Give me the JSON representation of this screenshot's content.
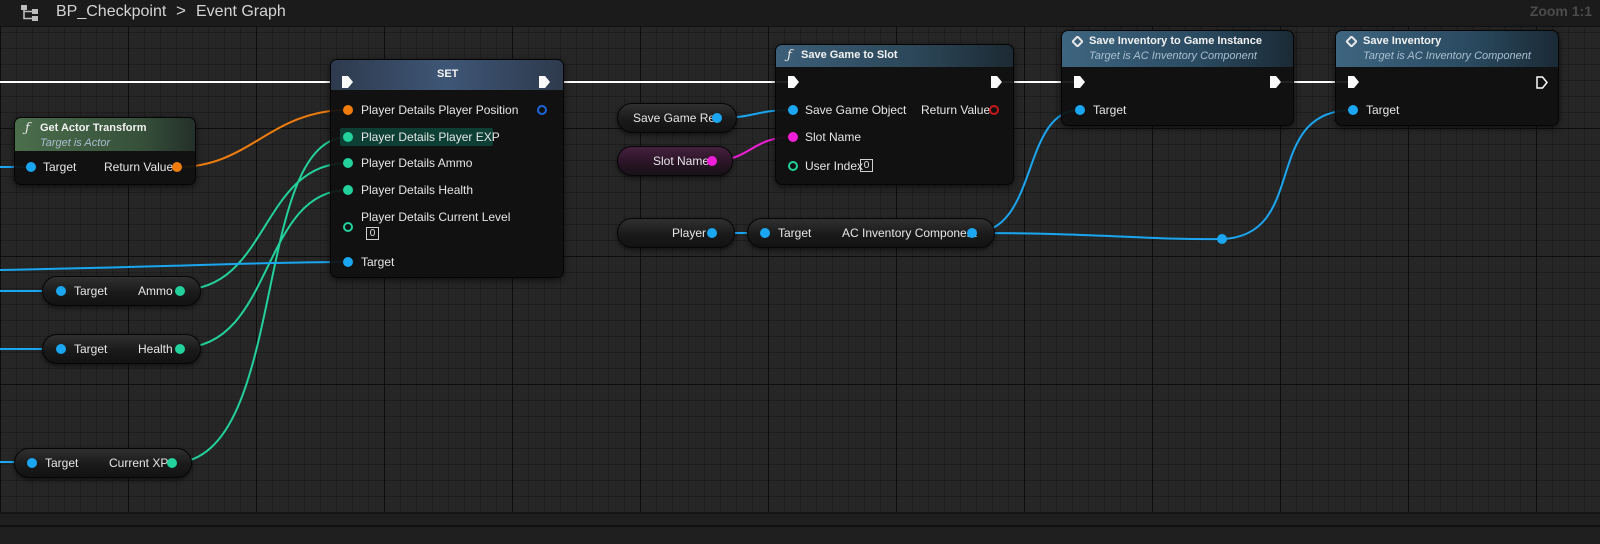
{
  "header": {
    "asset_name": "BP_Checkpoint",
    "separator": ">",
    "graph_name": "Event Graph",
    "zoom": "Zoom 1:1",
    "icon": "graph-hierarchy-icon"
  },
  "nodes": {
    "set": {
      "title": "SET",
      "pins": [
        "Player Details Player Position",
        "Player Details Player EXP",
        "Player Details Ammo",
        "Player Details Health",
        "Player Details Current Level",
        "Target"
      ],
      "current_level_value": "0"
    },
    "get_actor_transform": {
      "title": "Get Actor Transform",
      "subtitle": "Target is Actor",
      "input_label": "Target",
      "output_label": "Return Value",
      "icon": "function-icon"
    },
    "save_game_to_slot": {
      "title": "Save Game to Slot",
      "pins": [
        "Save Game Object",
        "Slot Name",
        "User Index"
      ],
      "output_label": "Return Value",
      "user_index_value": "0",
      "icon": "function-icon"
    },
    "save_inventory_to_game_instance": {
      "title": "Save Inventory to Game Instance",
      "subtitle": "Target is AC Inventory Component",
      "input_label": "Target",
      "icon": "event-diamond-icon"
    },
    "save_inventory": {
      "title": "Save Inventory",
      "subtitle": "Target is AC Inventory Component",
      "input_label": "Target",
      "icon": "event-diamond-icon"
    },
    "get_ammo": {
      "input_label": "Target",
      "output_label": "Ammo"
    },
    "get_health": {
      "input_label": "Target",
      "output_label": "Health"
    },
    "get_current_xp": {
      "input_label": "Target",
      "output_label": "Current XP"
    },
    "save_game_ref": {
      "label": "Save Game Ref"
    },
    "slot_name_var": {
      "label": "Slot Name"
    },
    "player_var": {
      "label": "Player"
    },
    "get_inventory_component": {
      "input_label": "Target",
      "output_label": "AC Inventory Component"
    }
  },
  "colors": {
    "object_pin": "#1aa6f0",
    "transform_pin": "#ef7d0e",
    "struct_pin": "#22d19b",
    "string_pin": "#f01ed7",
    "bool_pin": "#c81818",
    "set_header": "#3a4e6a",
    "function_header": "#3d5c3d",
    "blue_header": "#34566b"
  }
}
